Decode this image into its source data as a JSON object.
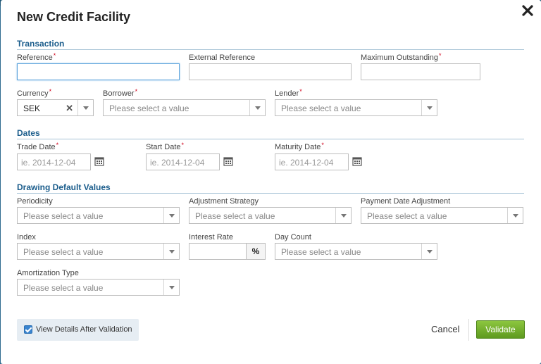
{
  "modal": {
    "title": "New Credit Facility"
  },
  "sections": {
    "transaction": "Transaction",
    "dates": "Dates",
    "drawing": "Drawing Default Values"
  },
  "fields": {
    "reference": {
      "label": "Reference",
      "value": ""
    },
    "external_reference": {
      "label": "External Reference",
      "value": ""
    },
    "maximum_outstanding": {
      "label": "Maximum Outstanding",
      "value": ""
    },
    "currency": {
      "label": "Currency",
      "value": "SEK"
    },
    "borrower": {
      "label": "Borrower",
      "placeholder": "Please select a value"
    },
    "lender": {
      "label": "Lender",
      "placeholder": "Please select a value"
    },
    "trade_date": {
      "label": "Trade Date",
      "placeholder": "ie. 2014-12-04"
    },
    "start_date": {
      "label": "Start Date",
      "placeholder": "ie. 2014-12-04"
    },
    "maturity_date": {
      "label": "Maturity Date",
      "placeholder": "ie. 2014-12-04"
    },
    "periodicity": {
      "label": "Periodicity",
      "placeholder": "Please select a value"
    },
    "adjustment_strategy": {
      "label": "Adjustment Strategy",
      "placeholder": "Please select a value"
    },
    "payment_date_adjustment": {
      "label": "Payment Date Adjustment",
      "placeholder": "Please select a value"
    },
    "index": {
      "label": "Index",
      "placeholder": "Please select a value"
    },
    "interest_rate": {
      "label": "Interest Rate",
      "value": "",
      "unit": "%"
    },
    "day_count": {
      "label": "Day Count",
      "placeholder": "Please select a value"
    },
    "amortization_type": {
      "label": "Amortization Type",
      "placeholder": "Please select a value"
    }
  },
  "required_marker": "*",
  "footer": {
    "view_details_label": "View Details After Validation",
    "view_details_checked": true,
    "cancel_label": "Cancel",
    "validate_label": "Validate"
  },
  "colors": {
    "section_heading": "#1b5d8c",
    "validate_button": "#6fae2a",
    "required": "#d0021b",
    "checkbox": "#3a85d0"
  }
}
